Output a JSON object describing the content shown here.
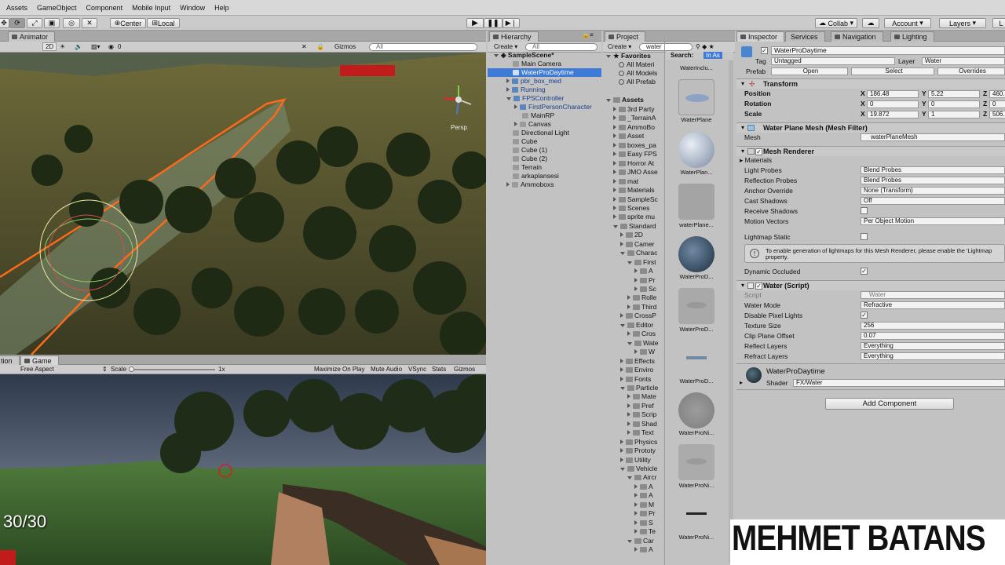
{
  "menu": [
    "Assets",
    "GameObject",
    "Component",
    "Mobile Input",
    "Window",
    "Help"
  ],
  "toolbar": {
    "center": "Center",
    "local": "Local",
    "collab": "Collab",
    "account": "Account",
    "layers": "Layers",
    "layout": "L"
  },
  "scene": {
    "tab": "Animator",
    "mode2d": "2D",
    "gizmos": "Gizmos",
    "search": "All",
    "zero": "0",
    "persp": "Persp"
  },
  "game": {
    "tab_left": "tion",
    "tab": "Game",
    "aspect": "Free Aspect",
    "scale": "Scale",
    "scale_val": "1x",
    "maximize": "Maximize On Play",
    "mute": "Mute Audio",
    "vsync": "VSync",
    "stats": "Stats",
    "gizmos": "Gizmos",
    "ammo": "30/30"
  },
  "hierarchy": {
    "tab": "Hierarchy",
    "create": "Create",
    "search": "All",
    "items": [
      "SampleScene*",
      "Main Camera",
      "WaterProDaytime",
      "pbr_box_med",
      "Running",
      "FPSController",
      "FirstPersonCharacter",
      "MainRP",
      "Canvas",
      "Directional Light",
      "Cube",
      "Cube (1)",
      "Cube (2)",
      "Terrain",
      "arkaplansesi",
      "Ammoboxs"
    ]
  },
  "project": {
    "tab": "Project",
    "create": "Create",
    "search": "water",
    "search_label": "Search:",
    "in_assets": "In As",
    "favorites": "Favorites",
    "fav_items": [
      "All Materi",
      "All Models",
      "All Prefab"
    ],
    "assets": "Assets",
    "tree": [
      "3rd Party",
      "_TerrainA",
      "AmmoBo",
      "Asset",
      "boxes_pa",
      "Easy FPS",
      "Horror At",
      "JMO Asse",
      "mat",
      "Materials",
      "SampleSc",
      "Scenes",
      "sprite mu",
      "Standard",
      "2D",
      "Camer",
      "Charac",
      "First",
      "A",
      "Pr",
      "Sc",
      "Rolle",
      "Third",
      "CrossP",
      "Editor",
      "Cros",
      "Wate",
      "W",
      "Effects",
      "Enviro",
      "Fonts",
      "Particle",
      "Mate",
      "Pref",
      "Scrip",
      "Shad",
      "Text",
      "Physics",
      "Prototy",
      "Utility",
      "Vehicle",
      "Aircr",
      "A",
      "A",
      "M",
      "Pr",
      "S",
      "Te",
      "Car",
      "A"
    ],
    "results": [
      "WaterInclu...",
      "WaterPlane",
      "WaterPlan...",
      "waterPlane...",
      "WaterProD...",
      "WaterProD...",
      "WaterProD...",
      "WaterProNi...",
      "WaterProNi...",
      "WaterProNi..."
    ]
  },
  "inspector": {
    "tabs": [
      "Inspector",
      "Services",
      "Navigation",
      "Lighting"
    ],
    "object_name": "WaterProDaytime",
    "tag_label": "Tag",
    "tag": "Untagged",
    "layer_label": "Layer",
    "layer": "Water",
    "prefab_label": "Prefab",
    "open": "Open",
    "select": "Select",
    "overrides": "Overrides",
    "transform": {
      "title": "Transform",
      "position": "Position",
      "rotation": "Rotation",
      "scale": "Scale",
      "px": "186.48",
      "py": "5.22",
      "pz": "460.",
      "rx": "0",
      "ry": "0",
      "rz": "0",
      "sx": "19.872",
      "sy": "1",
      "sz": "506."
    },
    "mesh_filter": {
      "title": "Water Plane Mesh (Mesh Filter)",
      "mesh_label": "Mesh",
      "mesh": "waterPlaneMesh"
    },
    "mesh_renderer": {
      "title": "Mesh Renderer",
      "materials": "Materials",
      "light_probes": "Light Probes",
      "light_probes_v": "Blend Probes",
      "reflection_probes": "Reflection Probes",
      "reflection_probes_v": "Blend Probes",
      "anchor": "Anchor Override",
      "anchor_v": "None (Transform)",
      "cast_shadows": "Cast Shadows",
      "cast_shadows_v": "Off",
      "receive_shadows": "Receive Shadows",
      "motion_vectors": "Motion Vectors",
      "motion_vectors_v": "Per Object Motion",
      "lightmap_static": "Lightmap Static",
      "info": "To enable generation of lightmaps for this Mesh Renderer, please enable the 'Lightmap property.",
      "dynamic_occluded": "Dynamic Occluded"
    },
    "water": {
      "title": "Water (Script)",
      "script": "Script",
      "script_v": "Water",
      "water_mode": "Water Mode",
      "water_mode_v": "Refractive",
      "disable_pixel": "Disable Pixel Lights",
      "texture_size": "Texture Size",
      "texture_size_v": "256",
      "clip_plane": "Clip Plane Offset",
      "clip_plane_v": "0.07",
      "reflect_layers": "Reflect Layers",
      "reflect_layers_v": "Everything",
      "refract_layers": "Refract Layers",
      "refract_layers_v": "Everything"
    },
    "material": {
      "name": "WaterProDaytime",
      "shader_label": "Shader",
      "shader": "FX/Water"
    },
    "add_component": "Add Component"
  },
  "watermark": "MEHMET BATANS",
  "colors": {
    "selection": "#3e7bd6",
    "orange": "#ff6a1a",
    "play_bg": "#e0e0e0"
  }
}
